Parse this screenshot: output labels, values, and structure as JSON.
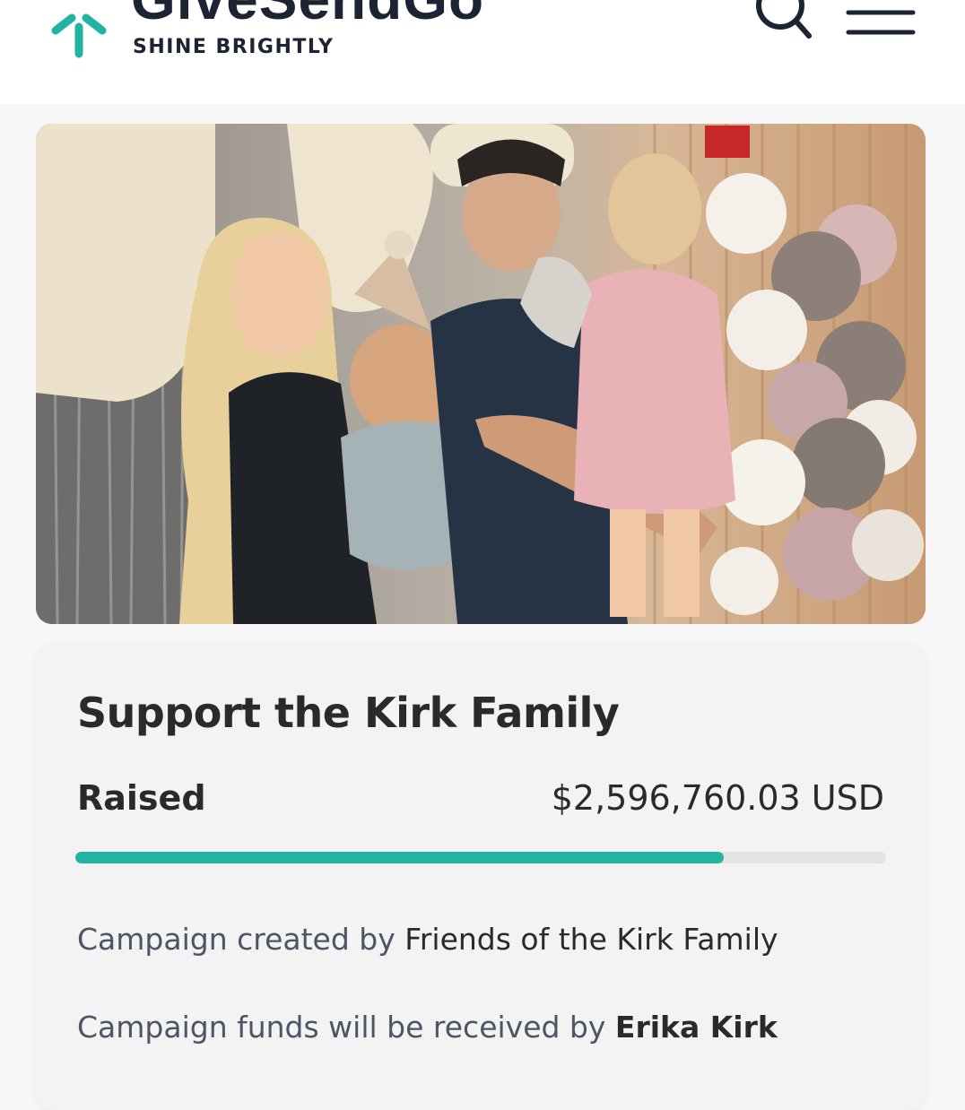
{
  "brand": {
    "name": "GiveSendGo",
    "tagline": "SHINE BRIGHTLY",
    "accent_color": "#22b3a1",
    "dark_color": "#1c2333"
  },
  "header": {
    "search_icon": "search-icon",
    "menu_icon": "hamburger-menu-icon"
  },
  "campaign": {
    "title": "Support the Kirk Family",
    "raised_label": "Raised",
    "raised_amount": "$2,596,760.03 USD",
    "progress_fraction": 0.8,
    "created_by_prefix": "Campaign created by ",
    "created_by": "Friends of the Kirk Family",
    "received_by_prefix": "Campaign funds will be received by ",
    "received_by": "Erika Kirk"
  }
}
